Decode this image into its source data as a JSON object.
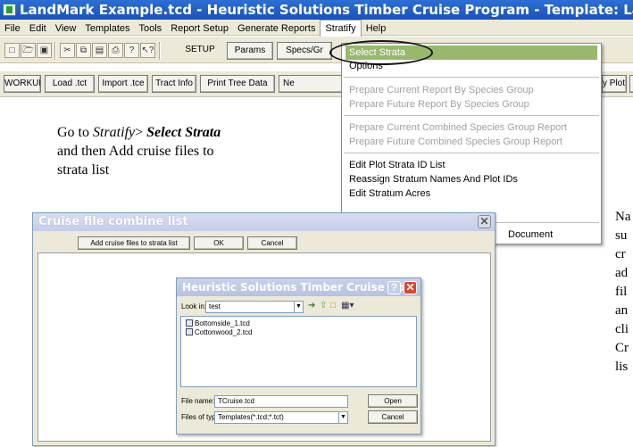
{
  "window": {
    "title": "LandMark Example.tcd - Heuristic Solutions Timber Cruise Program - Template: LandMark"
  },
  "menubar": {
    "items": [
      "File",
      "Edit",
      "View",
      "Templates",
      "Tools",
      "Report Setup",
      "Generate Reports",
      "Stratify",
      "Help"
    ]
  },
  "toolbar1": {
    "setup": "SETUP",
    "params": "Params",
    "specs": "Specs/Gr"
  },
  "toolbar2": {
    "workup": "WORKUP",
    "load_tct": "Load .tct",
    "import_tce": "Import .tce",
    "tract_info": "Tract Info",
    "print_tree_data": "Print Tree Data",
    "ne": "Ne",
    "by_plot": "y Plot"
  },
  "stratify_menu": {
    "select_strata": "Select Strata",
    "options": "Options",
    "prep_current_species": "Prepare Current Report By Species Group",
    "prep_future_species": "Prepare Future Report By Species Group",
    "prep_current_combined": "Prepare Current Combined Species Group Report",
    "prep_future_combined": "Prepare Future Combined Species Group Report",
    "edit_plot_strata": "Edit Plot Strata ID List",
    "reassign_stratum": "Reassign Stratum Names And Plot IDs",
    "edit_stratum_acres": "Edit Stratum Acres",
    "document": "Document"
  },
  "instruction": {
    "line1_pre": "Go to ",
    "line1_menu": "Stratify",
    "line1_sep": "> ",
    "line1_item": "Select Strata",
    "line2": "and then Add cruise files to",
    "line3": "strata list"
  },
  "right_text": [
    "Na",
    "su",
    "cr",
    "ad",
    "fil",
    "an",
    "cli",
    "Cr",
    "lis"
  ],
  "combine_dialog": {
    "title": "Cruise file combine list",
    "add_button": "Add cruise files to strata list",
    "ok_button": "OK",
    "cancel_button": "Cancel"
  },
  "open_dialog": {
    "title": "Heuristic Solutions Timber Cruise Do...",
    "look_in_label": "Look in:",
    "look_in_value": "test",
    "files": [
      "Bottomside_1.tcd",
      "Cottonwood_2.tcd"
    ],
    "file_name_label": "File name:",
    "file_name_value": "TCruise.tcd",
    "file_type_label": "Files of type:",
    "file_type_value": "Templates(*.tcd;*.tct)",
    "open_button": "Open",
    "cancel_button": "Cancel"
  }
}
